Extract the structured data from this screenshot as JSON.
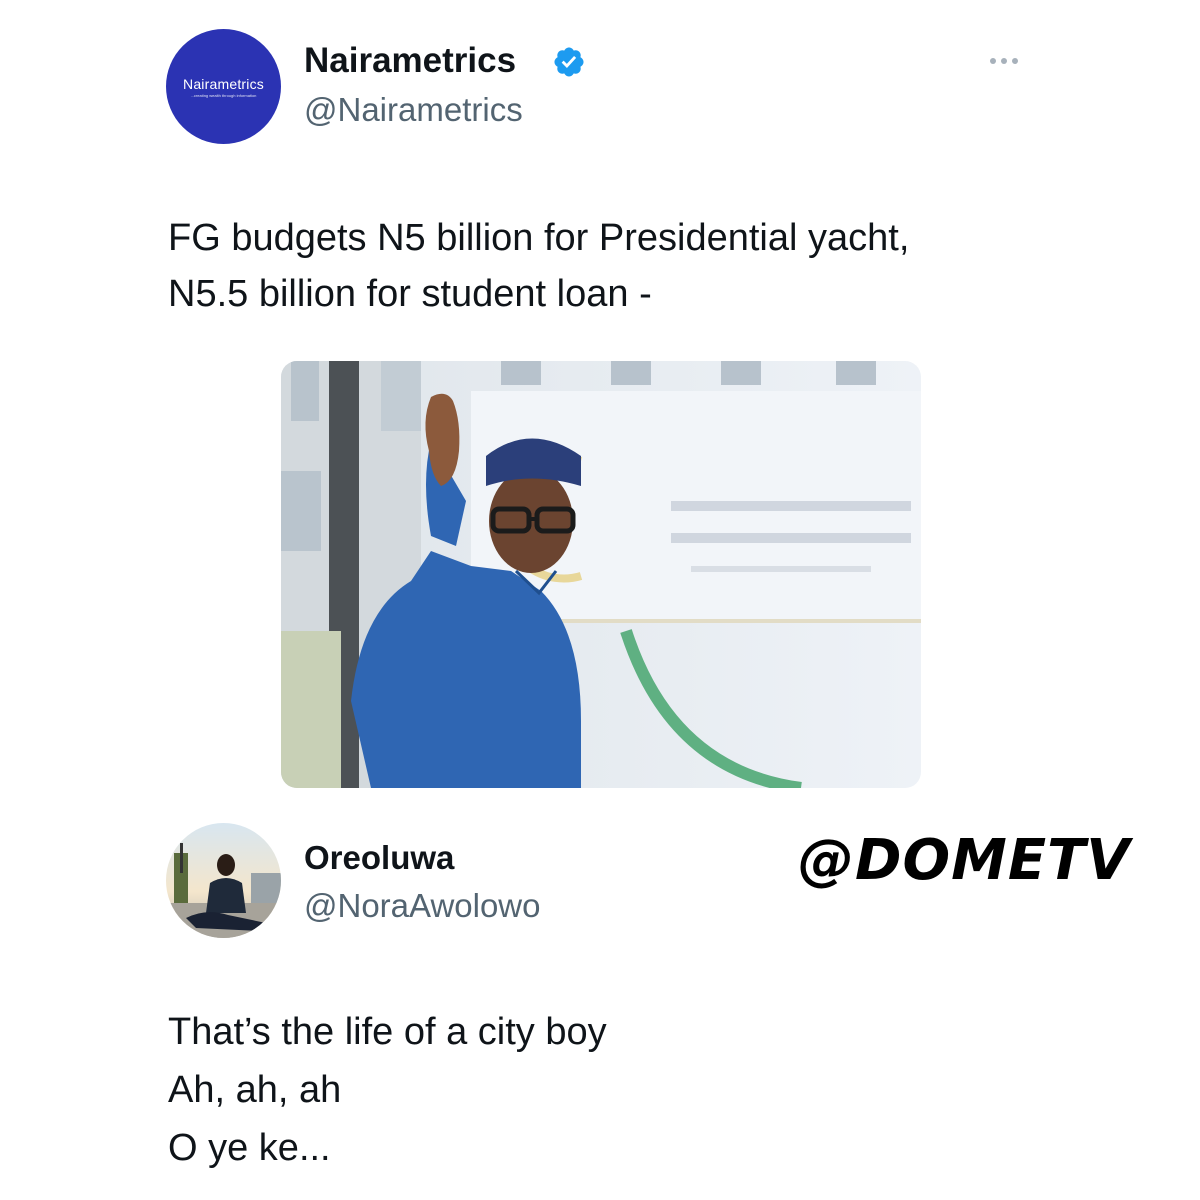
{
  "tweet": {
    "avatar": {
      "brand": "Nairametrics",
      "tagline": "...creating wealth through information"
    },
    "display_name": "Nairametrics",
    "handle": "@Nairametrics",
    "verified_icon": "verified-badge-icon",
    "more_icon": "more-options-icon",
    "text_line_1": "FG budgets N5 billion for Presidential yacht,",
    "text_line_2": "N5.5 billion for student loan -"
  },
  "reply": {
    "display_name": "Oreoluwa",
    "handle": "@NoraAwolowo",
    "lines": [
      "That’s the life of a city boy",
      "Ah, ah, ah",
      "O ye ke..."
    ]
  },
  "watermark": "@DOMETV",
  "colors": {
    "text": "#0f1419",
    "secondary": "#536471",
    "verified": "#1d9bf0",
    "avatar_bg": "#2b33b3"
  }
}
